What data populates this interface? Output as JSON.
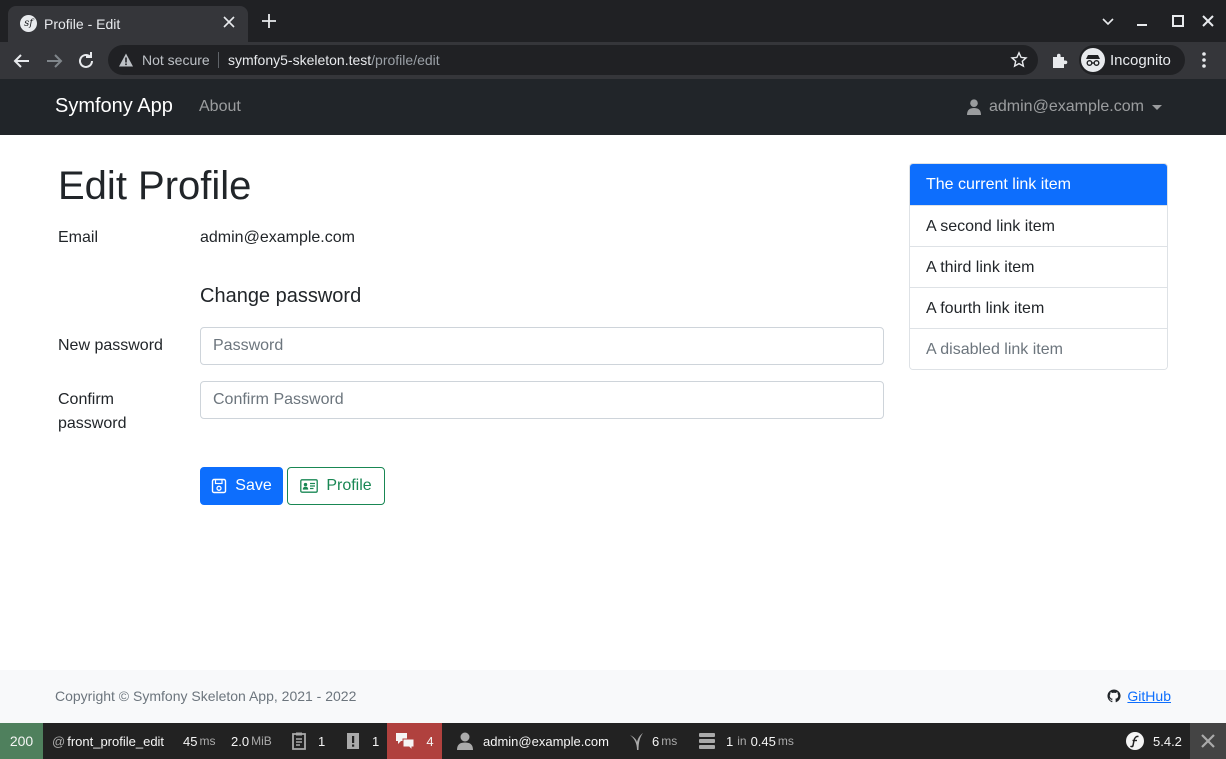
{
  "browser": {
    "tab_title": "Profile - Edit",
    "security_label": "Not secure",
    "url_host": "symfony5-skeleton.test",
    "url_path": "/profile/edit",
    "profile_label": "Incognito"
  },
  "navbar": {
    "brand": "Symfony App",
    "about": "About",
    "user": "admin@example.com"
  },
  "page": {
    "title": "Edit Profile",
    "email_label": "Email",
    "email_value": "admin@example.com",
    "change_password_heading": "Change password",
    "new_password_label": "New password",
    "new_password_placeholder": "Password",
    "confirm_password_label_line1": "Confirm",
    "confirm_password_label_line2": "password",
    "confirm_password_placeholder": "Confirm Password",
    "save_label": "Save",
    "profile_label": "Profile"
  },
  "sidebar": {
    "items": [
      {
        "label": "The current link item",
        "state": "active"
      },
      {
        "label": "A second link item",
        "state": "normal"
      },
      {
        "label": "A third link item",
        "state": "normal"
      },
      {
        "label": "A fourth link item",
        "state": "normal"
      },
      {
        "label": "A disabled link item",
        "state": "disabled"
      }
    ]
  },
  "footer": {
    "copyright": "Copyright © Symfony Skeleton App, 2021 - 2022",
    "github": "GitHub"
  },
  "debug_toolbar": {
    "status_code": "200",
    "route": "front_profile_edit",
    "time_value": "45",
    "time_unit": "ms",
    "memory_value": "2.0",
    "memory_unit": "MiB",
    "logs_count": "1",
    "errors_count": "1",
    "translations_count": "4",
    "user": "admin@example.com",
    "twig_value": "6",
    "twig_unit": "ms",
    "db_queries": "1",
    "db_in": "in",
    "db_time": "0.45",
    "db_unit": "ms",
    "symfony_version": "5.4.2"
  },
  "colors": {
    "primary": "#0d6efd",
    "success": "#198754",
    "navbar_bg": "#212529",
    "status_ok": "#4f805d",
    "translation_warning": "#b0413e"
  },
  "icons": {
    "tab": "symfony-favicon",
    "close_tab": "close-icon",
    "new_tab": "plus-icon",
    "back": "arrow-left-icon",
    "forward": "arrow-right-icon",
    "reload": "reload-icon",
    "security": "warning-triangle-icon",
    "bookmark": "star-icon",
    "extensions": "puzzle-icon",
    "incognito": "incognito-icon",
    "user": "user-icon",
    "save": "floppy-disk-icon",
    "profile": "id-card-icon",
    "github": "github-icon"
  }
}
